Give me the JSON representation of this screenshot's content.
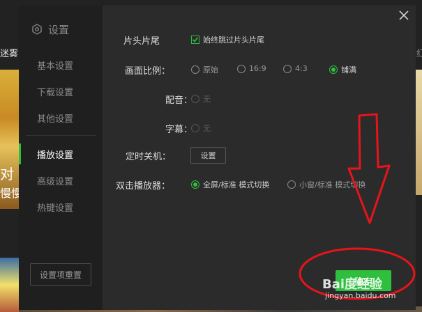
{
  "background": {
    "left_text_top": "迷雾",
    "left_text_mid": "对",
    "left_text_mid2": "慢慢",
    "right_text_top": "红"
  },
  "sidebar": {
    "title": "设置",
    "items": [
      {
        "label": "基本设置",
        "active": false
      },
      {
        "label": "下载设置",
        "active": false
      },
      {
        "label": "其他设置",
        "active": false
      },
      {
        "label": "播放设置",
        "active": true
      },
      {
        "label": "高级设置",
        "active": false
      },
      {
        "label": "热键设置",
        "active": false
      }
    ],
    "reset_label": "设置项重置"
  },
  "settings": {
    "head_tail": {
      "label": "片头片尾",
      "checkbox_label": "始终跳过片头片尾",
      "checked": true
    },
    "aspect": {
      "label": "画面比例：",
      "options": [
        "原始",
        "16:9",
        "4:3",
        "铺满"
      ],
      "selected": "铺满"
    },
    "dubbing": {
      "label": "配音：",
      "option": "无"
    },
    "subtitle": {
      "label": "字幕：",
      "option": "无"
    },
    "timer": {
      "label": "定时关机：",
      "button": "设置"
    },
    "double_click": {
      "label": "双击播放器：",
      "options": [
        "全屏/标准 模式切换",
        "小窗/标准 模式切换"
      ],
      "selected": "全屏/标准 模式切换"
    }
  },
  "footer": {
    "ok_label": "确定"
  },
  "watermark": {
    "brand": "Bai度经验",
    "url": "jingyan.baidu.com"
  },
  "colors": {
    "accent": "#2fbf3f",
    "annotation": "#e8141a"
  },
  "icons": {
    "settings": "hexagon-gear-icon",
    "close": "close-icon",
    "annotation_arrow": "down-arrow-annotation"
  }
}
